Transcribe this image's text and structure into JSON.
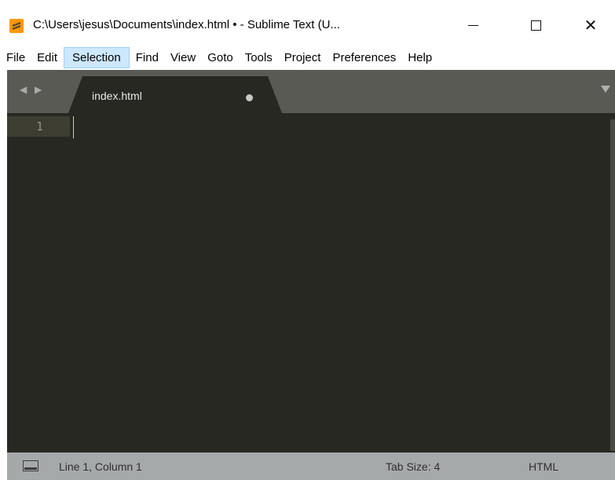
{
  "window": {
    "title": "C:\\Users\\jesus\\Documents\\index.html • - Sublime Text (U...",
    "icon": "sublime-text-logo",
    "controls": {
      "minimize": "minimize-icon",
      "maximize": "maximize-icon",
      "close": "✕"
    }
  },
  "menu": {
    "items": [
      "File",
      "Edit",
      "Selection",
      "Find",
      "View",
      "Goto",
      "Tools",
      "Project",
      "Preferences",
      "Help"
    ],
    "active": "Selection"
  },
  "tabs": [
    {
      "label": "index.html",
      "dirty": true,
      "active": true
    }
  ],
  "tabbar": {
    "nav_arrows": "◀ ▶",
    "dropdown_icon": "triangle-down-icon"
  },
  "editor": {
    "lines": [
      {
        "number": "1",
        "text": ""
      }
    ],
    "colors": {
      "background": "#272822",
      "gutter_highlight": "#3e3d32"
    }
  },
  "status": {
    "position": "Line 1, Column 1",
    "tab_size": "Tab Size: 4",
    "syntax": "HTML"
  }
}
